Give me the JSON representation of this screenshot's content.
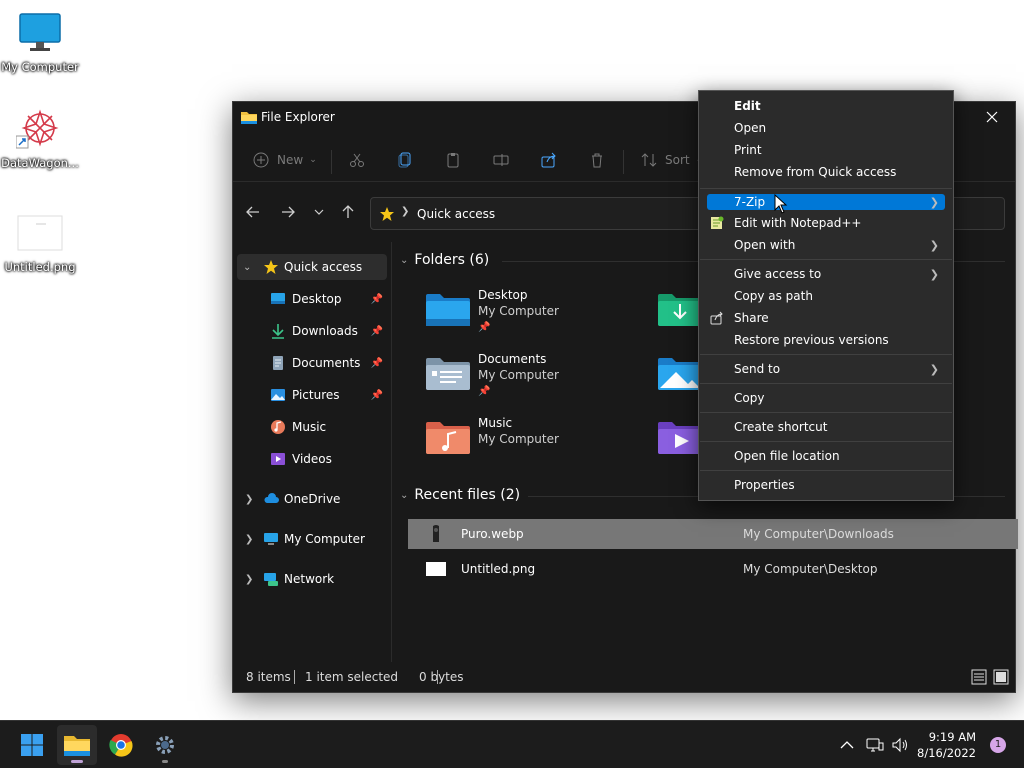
{
  "desktop": {
    "icons": [
      {
        "label": "My Computer"
      },
      {
        "label": "DataWagon..."
      },
      {
        "label": "Untitled.png"
      }
    ]
  },
  "window": {
    "title": "File Explorer",
    "toolbar": {
      "new_label": "New",
      "sort_label": "Sort"
    },
    "address": {
      "location": "Quick access"
    },
    "sidebar": {
      "quick_access": "Quick access",
      "items": [
        {
          "label": "Desktop"
        },
        {
          "label": "Downloads"
        },
        {
          "label": "Documents"
        },
        {
          "label": "Pictures"
        },
        {
          "label": "Music"
        },
        {
          "label": "Videos"
        }
      ],
      "onedrive": "OneDrive",
      "my_computer": "My Computer",
      "network": "Network"
    },
    "folders": {
      "header": "Folders (6)",
      "items": [
        {
          "name": "Desktop",
          "location": "My Computer"
        },
        {
          "name": "Documents",
          "location": "My Computer"
        },
        {
          "name": "Music",
          "location": "My Computer"
        }
      ]
    },
    "recent": {
      "header": "Recent files (2)",
      "files": [
        {
          "name": "Puro.webp",
          "path": "My Computer\\Downloads"
        },
        {
          "name": "Untitled.png",
          "path": "My Computer\\Desktop"
        }
      ]
    },
    "status": {
      "count": "8 items",
      "selection": "1 item selected",
      "size": "0 bytes"
    }
  },
  "context_menu": {
    "items": [
      {
        "label": "Edit"
      },
      {
        "label": "Open"
      },
      {
        "label": "Print"
      },
      {
        "label": "Remove from Quick access"
      },
      {
        "label": "7-Zip"
      },
      {
        "label": "Edit with Notepad++"
      },
      {
        "label": "Open with"
      },
      {
        "label": "Give access to"
      },
      {
        "label": "Copy as path"
      },
      {
        "label": "Share"
      },
      {
        "label": "Restore previous versions"
      },
      {
        "label": "Send to"
      },
      {
        "label": "Copy"
      },
      {
        "label": "Create shortcut"
      },
      {
        "label": "Open file location"
      },
      {
        "label": "Properties"
      }
    ],
    "highlight_color": "#0078d7"
  },
  "taskbar": {
    "time": "9:19 AM",
    "date": "8/16/2022",
    "notification_count": "1"
  }
}
